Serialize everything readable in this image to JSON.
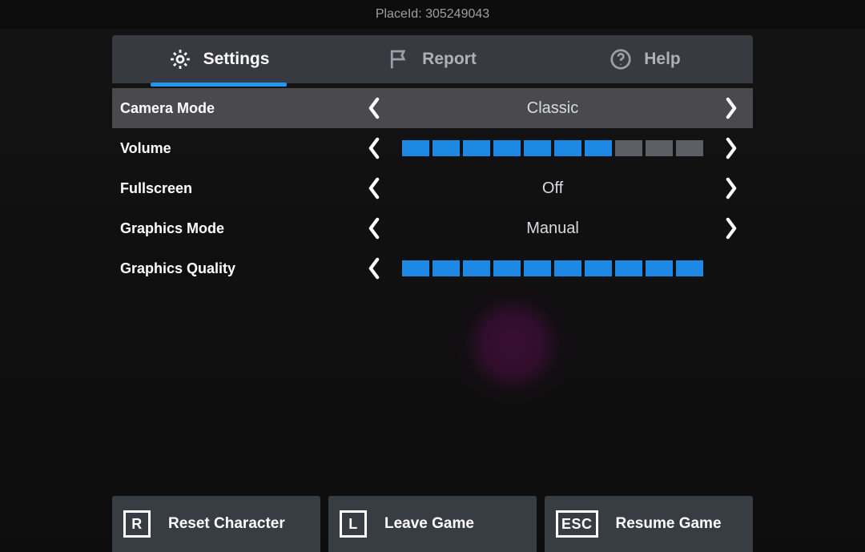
{
  "top": {
    "placeid_text": "PlaceId: 305249043"
  },
  "tabs": {
    "settings": "Settings",
    "report": "Report",
    "help": "Help",
    "active": "settings"
  },
  "rows": {
    "camera_mode": {
      "label": "Camera Mode",
      "value": "Classic"
    },
    "volume": {
      "label": "Volume",
      "filled": 7,
      "total": 10
    },
    "fullscreen": {
      "label": "Fullscreen",
      "value": "Off"
    },
    "graphics_mode": {
      "label": "Graphics Mode",
      "value": "Manual"
    },
    "graphics_quality": {
      "label": "Graphics Quality",
      "filled": 10,
      "total": 10
    }
  },
  "footer": {
    "reset": {
      "key": "R",
      "label": "Reset Character"
    },
    "leave": {
      "key": "L",
      "label": "Leave Game"
    },
    "resume": {
      "key": "ESC",
      "label": "Resume Game"
    }
  }
}
